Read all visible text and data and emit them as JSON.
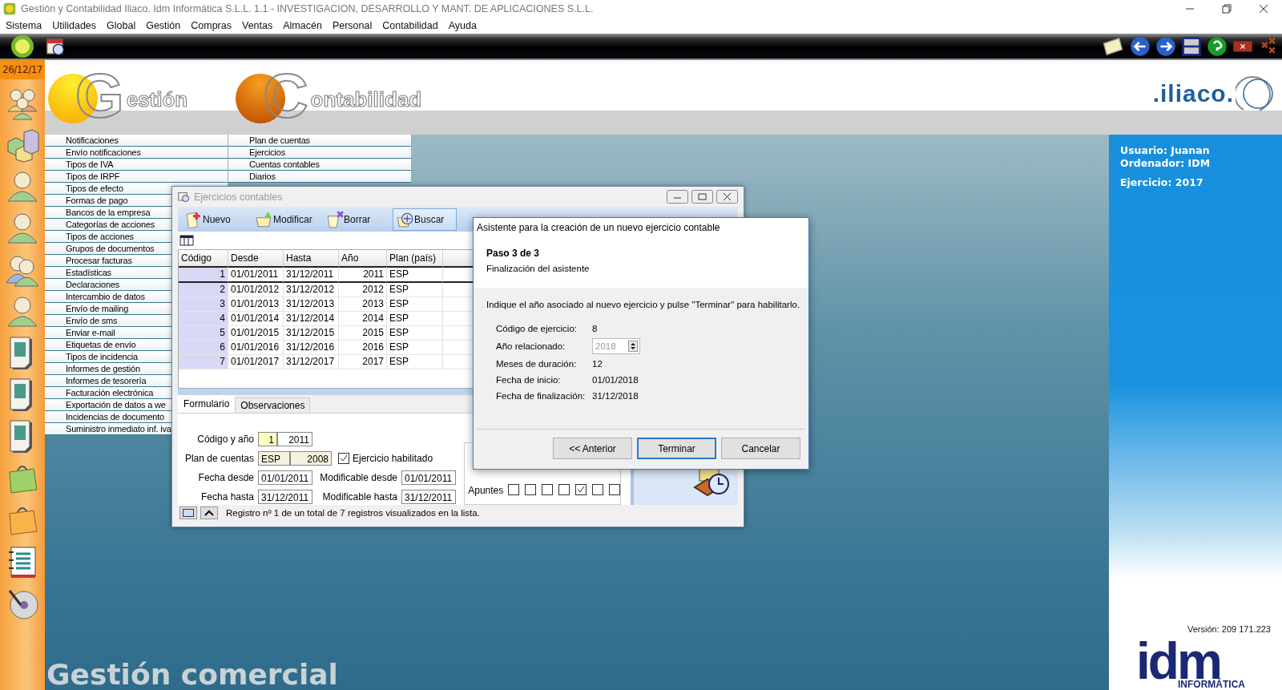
{
  "window": {
    "title": "Gestión y Contabilidad Iliaco. Idm Informática S.L.L. 1.1 - INVESTIGACION, DESARROLLO Y MANT. DE APLICACIONES S.L.L."
  },
  "menu": [
    "Sistema",
    "Utilidades",
    "Global",
    "Gestión",
    "Compras",
    "Ventas",
    "Almacén",
    "Personal",
    "Contabilidad",
    "Ayuda"
  ],
  "date": "26/12/17",
  "sidebar_icons": [
    {
      "kind": "users"
    },
    {
      "kind": "cubes"
    },
    {
      "kind": "person"
    },
    {
      "kind": "person"
    },
    {
      "kind": "people"
    },
    {
      "kind": "person"
    },
    {
      "kind": "document"
    },
    {
      "kind": "document"
    },
    {
      "kind": "document"
    },
    {
      "kind": "bag-green"
    },
    {
      "kind": "bag-orange"
    },
    {
      "kind": "notebook"
    },
    {
      "kind": "disc"
    }
  ],
  "logos": {
    "gestion": {
      "initial": "G",
      "rest": "estión"
    },
    "contabilidad": {
      "initial": "C",
      "rest": "ontabilidad"
    },
    "brand": ".iliaco."
  },
  "menu_columns": [
    [
      "Notificaciones",
      "Envío notificaciones",
      "Tipos de IVA",
      "Tipos de IRPF",
      "Tipos de efecto",
      "Formas de pago",
      "Bancos de la empresa",
      "Categorías de acciones",
      "Tipos de acciones",
      "Grupos de documentos",
      "Procesar facturas",
      "Estadísticas",
      "Declaraciones",
      "Intercambio de datos",
      "Envío de mailing",
      "Envío de sms",
      "Enviar e-mail",
      "Etiquetas de envío",
      "Tipos de incidencia",
      "Informes de gestión",
      "Informes de tesorería",
      "Facturación electrónica",
      "Exportación de datos a we",
      "Incidencias de documento",
      "Suministro inmediato inf. iva"
    ],
    [
      "Plan de cuentas",
      "Ejercicios",
      "Cuentas contables",
      "Diarios"
    ]
  ],
  "info": {
    "user": "Usuario: Juanan",
    "computer": "Ordenador: IDM",
    "year": "Ejercicio: 2017",
    "version": "Versión: 209 171.223"
  },
  "company_logo": {
    "name": "idm",
    "subtitle": "INFORMÁTICA"
  },
  "footer_title": "Gestión comercial",
  "dialog": {
    "title": "Ejercicios contables",
    "toolbar": [
      {
        "label": "Nuevo",
        "kind": "new",
        "selected": false
      },
      {
        "label": "Modificar",
        "kind": "edit",
        "selected": false
      },
      {
        "label": "Borrar",
        "kind": "delete",
        "selected": false
      },
      {
        "label": "Buscar",
        "kind": "search",
        "selected": true
      }
    ],
    "grid": {
      "columns": [
        "Código",
        "Desde",
        "Hasta",
        "Año",
        "Plan (país)"
      ],
      "rows": [
        {
          "code": "1",
          "from": "01/01/2011",
          "to": "31/12/2011",
          "year": "2011",
          "plan": "ESP",
          "selected": true
        },
        {
          "code": "2",
          "from": "01/01/2012",
          "to": "31/12/2012",
          "year": "2012",
          "plan": "ESP",
          "selected": false
        },
        {
          "code": "3",
          "from": "01/01/2013",
          "to": "31/12/2013",
          "year": "2013",
          "plan": "ESP",
          "selected": false
        },
        {
          "code": "4",
          "from": "01/01/2014",
          "to": "31/12/2014",
          "year": "2014",
          "plan": "ESP",
          "selected": false
        },
        {
          "code": "5",
          "from": "01/01/2015",
          "to": "31/12/2015",
          "year": "2015",
          "plan": "ESP",
          "selected": false
        },
        {
          "code": "6",
          "from": "01/01/2016",
          "to": "31/12/2016",
          "year": "2016",
          "plan": "ESP",
          "selected": false
        },
        {
          "code": "7",
          "from": "01/01/2017",
          "to": "31/12/2017",
          "year": "2017",
          "plan": "ESP",
          "selected": false
        }
      ]
    },
    "tabs": [
      {
        "label": "Formulario",
        "selected": true
      },
      {
        "label": "Observaciones",
        "selected": false
      }
    ],
    "form": {
      "code_label": "Código y año",
      "code": "1",
      "year": "2011",
      "plan_label": "Plan de cuentas",
      "plan": "ESP",
      "plan_year": "2008",
      "enabled": {
        "label": "Ejercicio habilitado",
        "checked": true
      },
      "from_label": "Fecha desde",
      "from": "01/01/2011",
      "mod_from_label": "Modificable desde",
      "mod_from": "01/01/2011",
      "to_label": "Fecha hasta",
      "to": "31/12/2011",
      "mod_to_label": "Modificable hasta",
      "mod_to": "31/12/2011",
      "entries": {
        "label": "Apuntes",
        "checks": [
          {
            "checked": false
          },
          {
            "checked": false
          },
          {
            "checked": false
          },
          {
            "checked": false
          },
          {
            "checked": true
          },
          {
            "checked": false
          },
          {
            "checked": false
          }
        ]
      }
    },
    "status": "Registro nº 1 de un total de 7 registros visualizados en la lista."
  },
  "wizard": {
    "title": "Asistente para la creación de un nuevo ejercicio contable",
    "step": "Paso 3 de 3",
    "subtitle": "Finalización del asistente",
    "instruction": "Indique el año asociado al nuevo ejercicio y pulse \"Terminar\" para habilitarlo.",
    "fields": [
      {
        "label": "Código de ejercicio:",
        "value": "8",
        "kind": "text"
      },
      {
        "label": "Año relacionado:",
        "value": "2018",
        "kind": "spinner",
        "disabled": true
      },
      {
        "label": "Meses de duración:",
        "value": "12",
        "kind": "text"
      },
      {
        "label": "Fecha de inicio:",
        "value": "01/01/2018",
        "kind": "text"
      },
      {
        "label": "Fecha de finalización:",
        "value": "31/12/2018",
        "kind": "text"
      }
    ],
    "buttons": [
      {
        "label": "<< Anterior",
        "default": false
      },
      {
        "label": "Terminar",
        "default": true
      },
      {
        "label": "Cancelar",
        "default": false
      }
    ]
  }
}
